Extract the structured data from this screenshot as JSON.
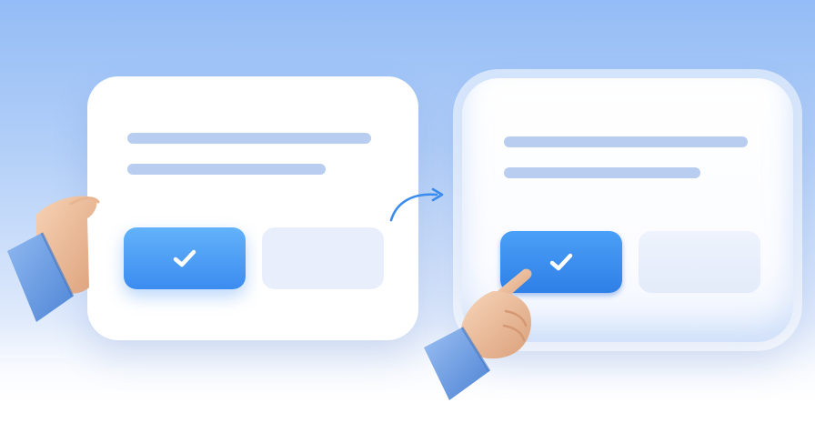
{
  "scene": {
    "background_top": "#94bcf6",
    "background_bottom": "#ffffff",
    "accent": "#3b8cf0"
  },
  "cards": [
    {
      "state": "default",
      "confirm_button_icon": "checkmark-icon",
      "secondary_button_label": ""
    },
    {
      "state": "pressed",
      "confirm_button_icon": "checkmark-icon",
      "secondary_button_label": ""
    }
  ],
  "transition_arrow_icon": "curved-arrow-icon",
  "hands": [
    "hand-holding-card-icon",
    "pointing-hand-icon"
  ]
}
